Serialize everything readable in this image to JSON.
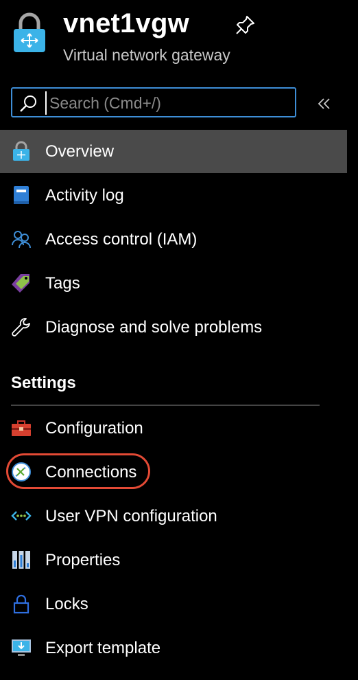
{
  "header": {
    "title": "vnet1vgw",
    "subtitle": "Virtual network gateway",
    "resource_icon": "lock-gateway-icon",
    "pin_icon": "pin-icon"
  },
  "search": {
    "placeholder": "Search (Cmd+/)",
    "value": "",
    "icon": "search-icon",
    "collapse_icon": "double-chevron-left-icon"
  },
  "nav": {
    "items": [
      {
        "label": "Overview",
        "icon": "lock-gateway-icon",
        "active": true
      },
      {
        "label": "Activity log",
        "icon": "activity-log-icon"
      },
      {
        "label": "Access control (IAM)",
        "icon": "people-icon"
      },
      {
        "label": "Tags",
        "icon": "tag-icon"
      },
      {
        "label": "Diagnose and solve problems",
        "icon": "wrench-icon"
      }
    ],
    "settings_title": "Settings",
    "settings_items": [
      {
        "label": "Configuration",
        "icon": "toolbox-icon"
      },
      {
        "label": "Connections",
        "icon": "connections-icon",
        "highlighted": true
      },
      {
        "label": "User VPN configuration",
        "icon": "vpn-icon"
      },
      {
        "label": "Properties",
        "icon": "properties-icon"
      },
      {
        "label": "Locks",
        "icon": "lock-icon"
      },
      {
        "label": "Export template",
        "icon": "export-template-icon"
      }
    ]
  },
  "colors": {
    "background": "#000000",
    "active_item": "#4a4a4a",
    "search_border": "#3e8ed7",
    "highlight_ring": "#e34a35",
    "subtitle": "#c8c8c8"
  }
}
